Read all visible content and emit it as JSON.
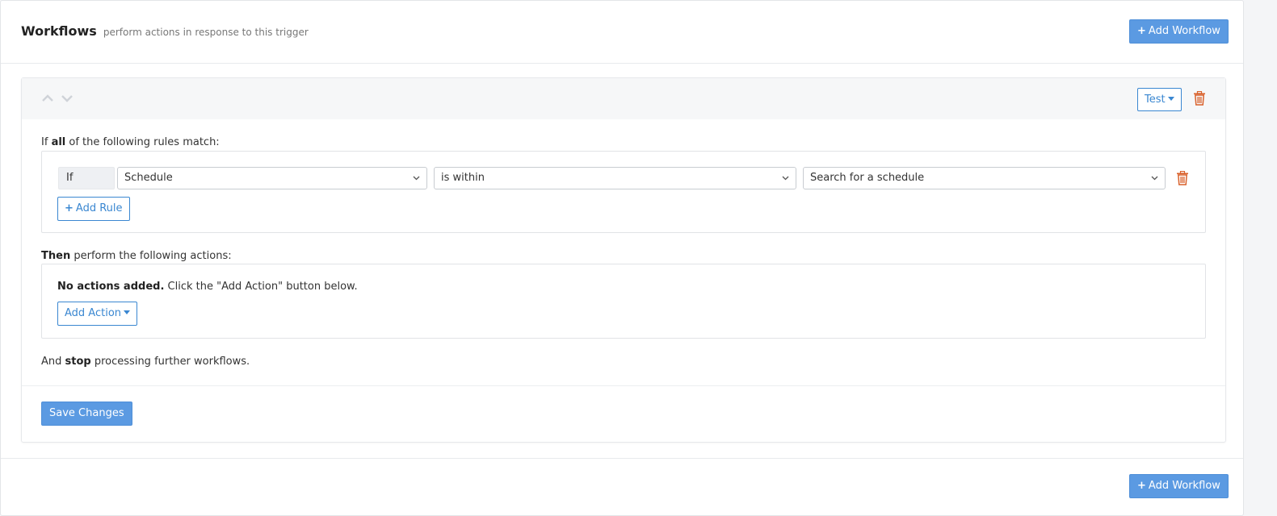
{
  "header": {
    "title": "Workflows",
    "subtitle": "perform actions in response to this trigger",
    "add_workflow_label": "Add Workflow"
  },
  "workflow": {
    "test_label": "Test",
    "rules_intro": {
      "prefix": "If",
      "emphasis": "all",
      "suffix": "of the following rules match:"
    },
    "rule": {
      "if_label": "If",
      "field": "Schedule",
      "operator": "is within",
      "value_placeholder": "Search for a schedule"
    },
    "add_rule_label": "Add Rule",
    "actions_intro": {
      "emphasis": "Then",
      "suffix": "perform the following actions:"
    },
    "no_actions": {
      "emphasis": "No actions added.",
      "text": "Click the \"Add Action\" button below."
    },
    "add_action_label": "Add Action",
    "stop_text": {
      "prefix": "And",
      "emphasis": "stop",
      "suffix": "processing further workflows."
    },
    "save_label": "Save Changes"
  },
  "footer": {
    "add_workflow_label": "Add Workflow"
  },
  "colors": {
    "primary": "#5b9ae2",
    "link": "#3a87d1",
    "danger": "#d9612b"
  },
  "icons": [
    "plus-icon",
    "chevron-up-icon",
    "chevron-down-icon",
    "caret-down-icon",
    "trash-icon"
  ]
}
